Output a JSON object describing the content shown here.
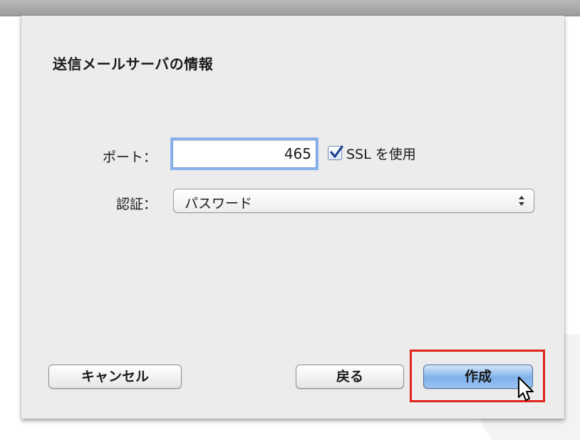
{
  "dialog": {
    "title": "送信メールサーバの情報"
  },
  "form": {
    "port_label": "ポート：",
    "port_value": "465",
    "ssl_checked": true,
    "ssl_label": "SSL を使用",
    "auth_label": "認証：",
    "auth_value": "パスワード"
  },
  "buttons": {
    "cancel_label": "キャンセル",
    "back_label": "戻る",
    "create_label": "作成"
  },
  "icons": {
    "checkbox": "checkmark-icon",
    "select": "chevron-updown-icon",
    "pointer": "mouse-pointer-icon"
  },
  "colors": {
    "highlight": "#e0241b",
    "default_button": "#7fb0ea",
    "focus_ring": "#8ab4ee"
  }
}
